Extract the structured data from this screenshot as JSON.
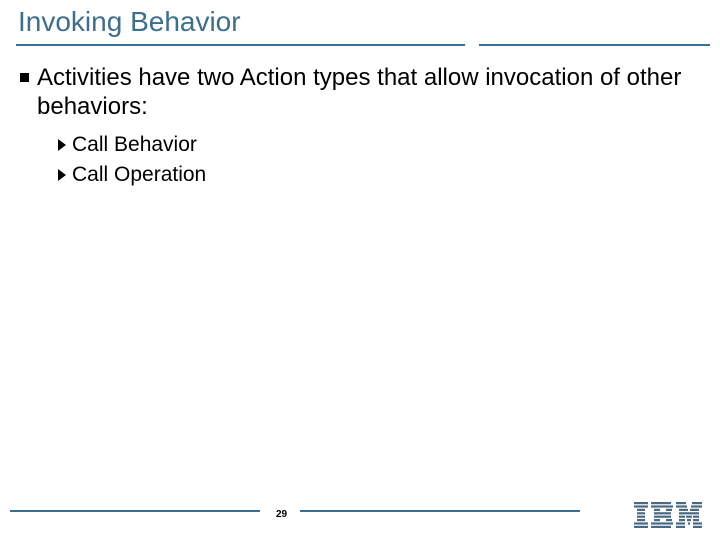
{
  "title": "Invoking Behavior",
  "bullet": "Activities have two Action types that allow invocation of other behaviors:",
  "subitems": [
    "Call Behavior",
    "Call Operation"
  ],
  "page_number": "29"
}
